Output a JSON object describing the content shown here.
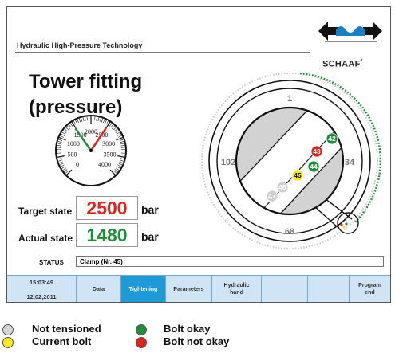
{
  "brand": {
    "name": "SCHAAF",
    "registered": "°",
    "colors": {
      "arrow": "#111111",
      "wave": "#1a7fc1"
    }
  },
  "header": {
    "subtitle": "Hydraulic High-Pressure Technology",
    "title_line1": "Tower fitting",
    "title_line2": "(pressure)"
  },
  "gauge": {
    "scale_labels": [
      "0",
      "500",
      "1000",
      "1500",
      "2000",
      "2500",
      "3000",
      "3500",
      "4000"
    ],
    "scale_max": 4000,
    "target_value": 2500,
    "actual_value": 1480,
    "target_needle_color": "#e0211d",
    "actual_needle_color": "#1c8f3a"
  },
  "target_state": {
    "label": "Target state",
    "value": "2500",
    "unit": "bar",
    "color": "#e0211d"
  },
  "actual_state": {
    "label": "Actual state",
    "value": "1480",
    "unit": "bar",
    "color": "#1c8f3a"
  },
  "flange": {
    "labels": {
      "top": "1",
      "left": "102",
      "right": "34",
      "bottom": "68"
    },
    "bolts": [
      {
        "number": "42",
        "state": "okay",
        "color": "#1c8f3a"
      },
      {
        "number": "43",
        "state": "not_okay",
        "color": "#e0211d"
      },
      {
        "number": "44",
        "state": "okay",
        "color": "#1c8f3a"
      },
      {
        "number": "45",
        "state": "current",
        "color": "#f2e31b"
      },
      {
        "number": "46",
        "state": "not_tensioned",
        "color": "#cfcfcf"
      },
      {
        "number": "47",
        "state": "not_tensioned",
        "color": "#cfcfcf"
      }
    ]
  },
  "status": {
    "label": "STATUS",
    "value": "Clamp (Nr. 45)"
  },
  "toolbar": {
    "time": "15:03:49",
    "date": "12,02,2011",
    "buttons": [
      {
        "label": "Data",
        "active": false
      },
      {
        "label": "Tightening",
        "active": true
      },
      {
        "label": "Parameters",
        "active": false
      },
      {
        "label": "Hydraulic\nhand",
        "active": false
      },
      {
        "label": "",
        "active": false
      },
      {
        "label": "",
        "active": false
      },
      {
        "label": "Program\nend",
        "active": false
      }
    ]
  },
  "legend": {
    "not_tensioned": {
      "label": "Not tensioned",
      "color": "#d4d4d4"
    },
    "current_bolt": {
      "label": "Current bolt",
      "color": "#f7ea1e"
    },
    "bolt_okay": {
      "label": "Bolt okay",
      "color": "#1c8f3a"
    },
    "bolt_not_okay": {
      "label": "Bolt not okay",
      "color": "#e0211d"
    }
  }
}
